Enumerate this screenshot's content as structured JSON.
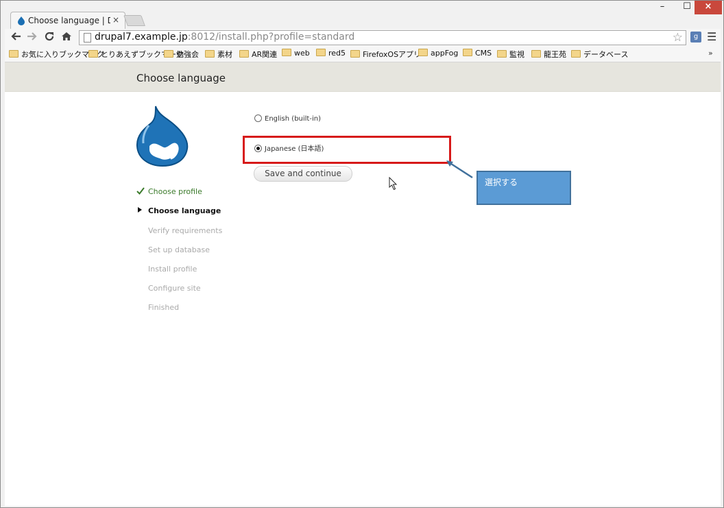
{
  "browser": {
    "tab_title": "Choose language | Drupal",
    "tab_close": "×",
    "url_host": "drupal7.example.jp",
    "url_rest": ":8012/install.php?profile=standard",
    "window_controls": {
      "minimize": "–",
      "maximize": "☐",
      "close": "×"
    },
    "bookmarks": [
      "お気に入りブックマーク",
      "とりあえずブックマーク",
      "勉強会",
      "素材",
      "AR関連",
      "web",
      "red5",
      "FirefoxOSアプリ",
      "appFog",
      "CMS",
      "監視",
      "龍王苑",
      "データベース"
    ],
    "bookmarks_more": "»"
  },
  "page": {
    "title": "Choose language",
    "steps": [
      {
        "label": "Choose profile",
        "state": "done"
      },
      {
        "label": "Choose language",
        "state": "active"
      },
      {
        "label": "Verify requirements",
        "state": "todo"
      },
      {
        "label": "Set up database",
        "state": "todo"
      },
      {
        "label": "Install profile",
        "state": "todo"
      },
      {
        "label": "Configure site",
        "state": "todo"
      },
      {
        "label": "Finished",
        "state": "todo"
      }
    ],
    "options": [
      {
        "label": "English (built-in)",
        "checked": false
      },
      {
        "label": "Japanese (日本語)",
        "checked": true
      }
    ],
    "submit_label": "Save and continue"
  },
  "annotation": {
    "callout_text": "選択する",
    "highlight_color": "#d71919",
    "callout_color": "#5b9bd5"
  }
}
